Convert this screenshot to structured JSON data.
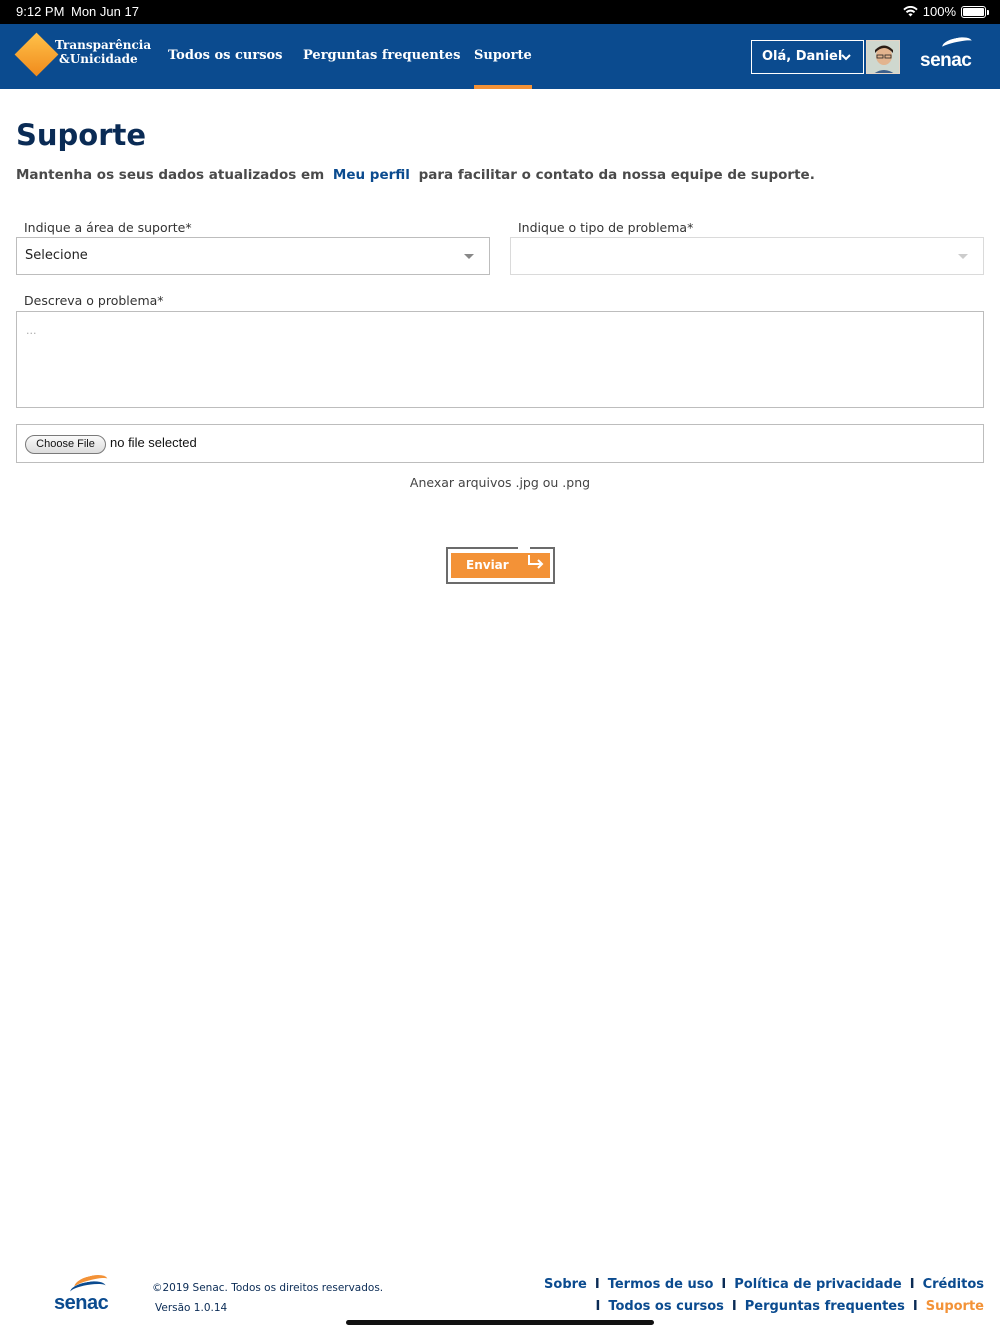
{
  "status_bar": {
    "time": "9:12 PM",
    "date": "Mon Jun 17",
    "battery": "100%"
  },
  "header": {
    "logo_line1": "Transparência",
    "logo_line2": "&Unicidade",
    "nav": [
      {
        "label": "Todos os cursos",
        "active": false
      },
      {
        "label": "Perguntas frequentes",
        "active": false
      },
      {
        "label": "Suporte",
        "active": true
      }
    ],
    "greeting": "Olá, Daniel",
    "brand": "senac",
    "colors": {
      "bar": "#0b4b8f",
      "accent": "#f39237"
    }
  },
  "main": {
    "title": "Suporte",
    "intro_before": "Mantenha os seus dados atualizados em",
    "intro_link": "Meu perfil",
    "intro_after": "para facilitar o contato da nossa equipe de suporte.",
    "area_label": "Indique a área de suporte*",
    "area_value": "Selecione",
    "type_label": "Indique o tipo de problema*",
    "type_value": "",
    "describe_label": "Descreva o problema*",
    "describe_placeholder": "...",
    "file_button": "Choose File",
    "file_status": "no file selected",
    "attach_hint": "Anexar arquivos .jpg ou .png",
    "submit": "Enviar"
  },
  "footer": {
    "copyright": "©2019 Senac. Todos os direitos reservados.",
    "version": "Versão 1.0.14",
    "brand": "senac",
    "links_row1": [
      "Sobre",
      "Termos de uso",
      "Política de privacidade",
      "Créditos"
    ],
    "links_row2": [
      "Todos os cursos",
      "Perguntas frequentes",
      "Suporte"
    ]
  }
}
